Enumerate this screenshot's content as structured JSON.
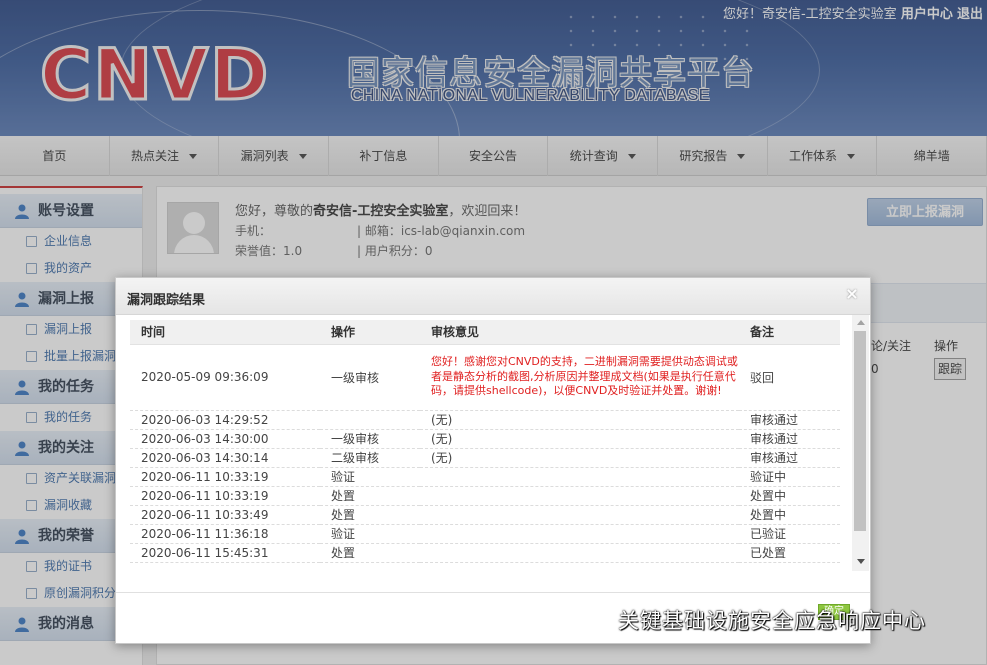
{
  "header": {
    "logo": "CNVD",
    "title_cn": "国家信息安全漏洞共享平台",
    "title_en": "CHINA NATIONAL VULNERABILITY DATABASE",
    "greeting": "您好！奇安信-工控安全实验室",
    "user_center": "用户中心",
    "logout": "退出"
  },
  "nav": [
    {
      "label": "首页",
      "dropdown": false
    },
    {
      "label": "热点关注",
      "dropdown": true
    },
    {
      "label": "漏洞列表",
      "dropdown": true
    },
    {
      "label": "补丁信息",
      "dropdown": false
    },
    {
      "label": "安全公告",
      "dropdown": false
    },
    {
      "label": "统计查询",
      "dropdown": true
    },
    {
      "label": "研究报告",
      "dropdown": true
    },
    {
      "label": "工作体系",
      "dropdown": true
    },
    {
      "label": "绵羊墙",
      "dropdown": false
    }
  ],
  "sidebar": {
    "sections": [
      {
        "title": "账号设置",
        "items": [
          "企业信息",
          "我的资产"
        ]
      },
      {
        "title": "漏洞上报",
        "items": [
          "漏洞上报",
          "批量上报漏洞"
        ]
      },
      {
        "title": "我的任务",
        "items": [
          "我的任务"
        ]
      },
      {
        "title": "我的关注",
        "items": [
          "资产关联漏洞",
          "漏洞收藏"
        ]
      },
      {
        "title": "我的荣誉",
        "items": [
          "我的证书",
          "原创漏洞积分"
        ]
      },
      {
        "title": "我的消息",
        "items": []
      }
    ]
  },
  "profile": {
    "greeting_prefix": "您好，尊敬的",
    "org": "奇安信-工控安全实验室",
    "greeting_suffix": "，欢迎回来！",
    "phone_label": "手机：",
    "email": "| 邮箱：ics-lab@qianxin.com",
    "reputation": "荣誉值：1.0",
    "points": "| 用户积分：0",
    "report_button": "立即上报漏洞"
  },
  "background_table": {
    "col_comment": "论/关注",
    "col_action": "操作",
    "value": "0",
    "track_button": "跟踪"
  },
  "modal": {
    "title": "漏洞跟踪结果",
    "close": "×",
    "columns": [
      "时间",
      "操作",
      "审核意见",
      "备注"
    ],
    "rows": [
      {
        "time": "2020-05-09 09:36:09",
        "action": "一级审核",
        "opinion": "您好！感谢您对CNVD的支持，二进制漏洞需要提供动态调试或者是静态分析的截图,分析原因并整理成文档(如果是执行任意代码，请提供shellcode)，以便CNVD及时验证并处置。谢谢!",
        "remark": "驳回"
      },
      {
        "time": "2020-06-03 14:29:52",
        "action": "",
        "opinion": "(无)",
        "remark": "审核通过"
      },
      {
        "time": "2020-06-03 14:30:00",
        "action": "一级审核",
        "opinion": "(无)",
        "remark": "审核通过"
      },
      {
        "time": "2020-06-03 14:30:14",
        "action": "二级审核",
        "opinion": "(无)",
        "remark": "审核通过"
      },
      {
        "time": "2020-06-11 10:33:19",
        "action": "验证",
        "opinion": "",
        "remark": "验证中"
      },
      {
        "time": "2020-06-11 10:33:19",
        "action": "处置",
        "opinion": "",
        "remark": "处置中"
      },
      {
        "time": "2020-06-11 10:33:49",
        "action": "处置",
        "opinion": "",
        "remark": "处置中"
      },
      {
        "time": "2020-06-11 11:36:18",
        "action": "验证",
        "opinion": "",
        "remark": "已验证"
      },
      {
        "time": "2020-06-11 15:45:31",
        "action": "处置",
        "opinion": "",
        "remark": "已处置"
      }
    ],
    "confirm_button": "确定"
  },
  "watermark": {
    "text": "关键基础设施安全应急响应中心"
  },
  "colors": {
    "banner": "#3a5d9c",
    "logo_red": "#d9363e",
    "accent_red": "#c92b2b",
    "opinion_red": "#e02020",
    "confirm_green": "#8dc63f"
  }
}
